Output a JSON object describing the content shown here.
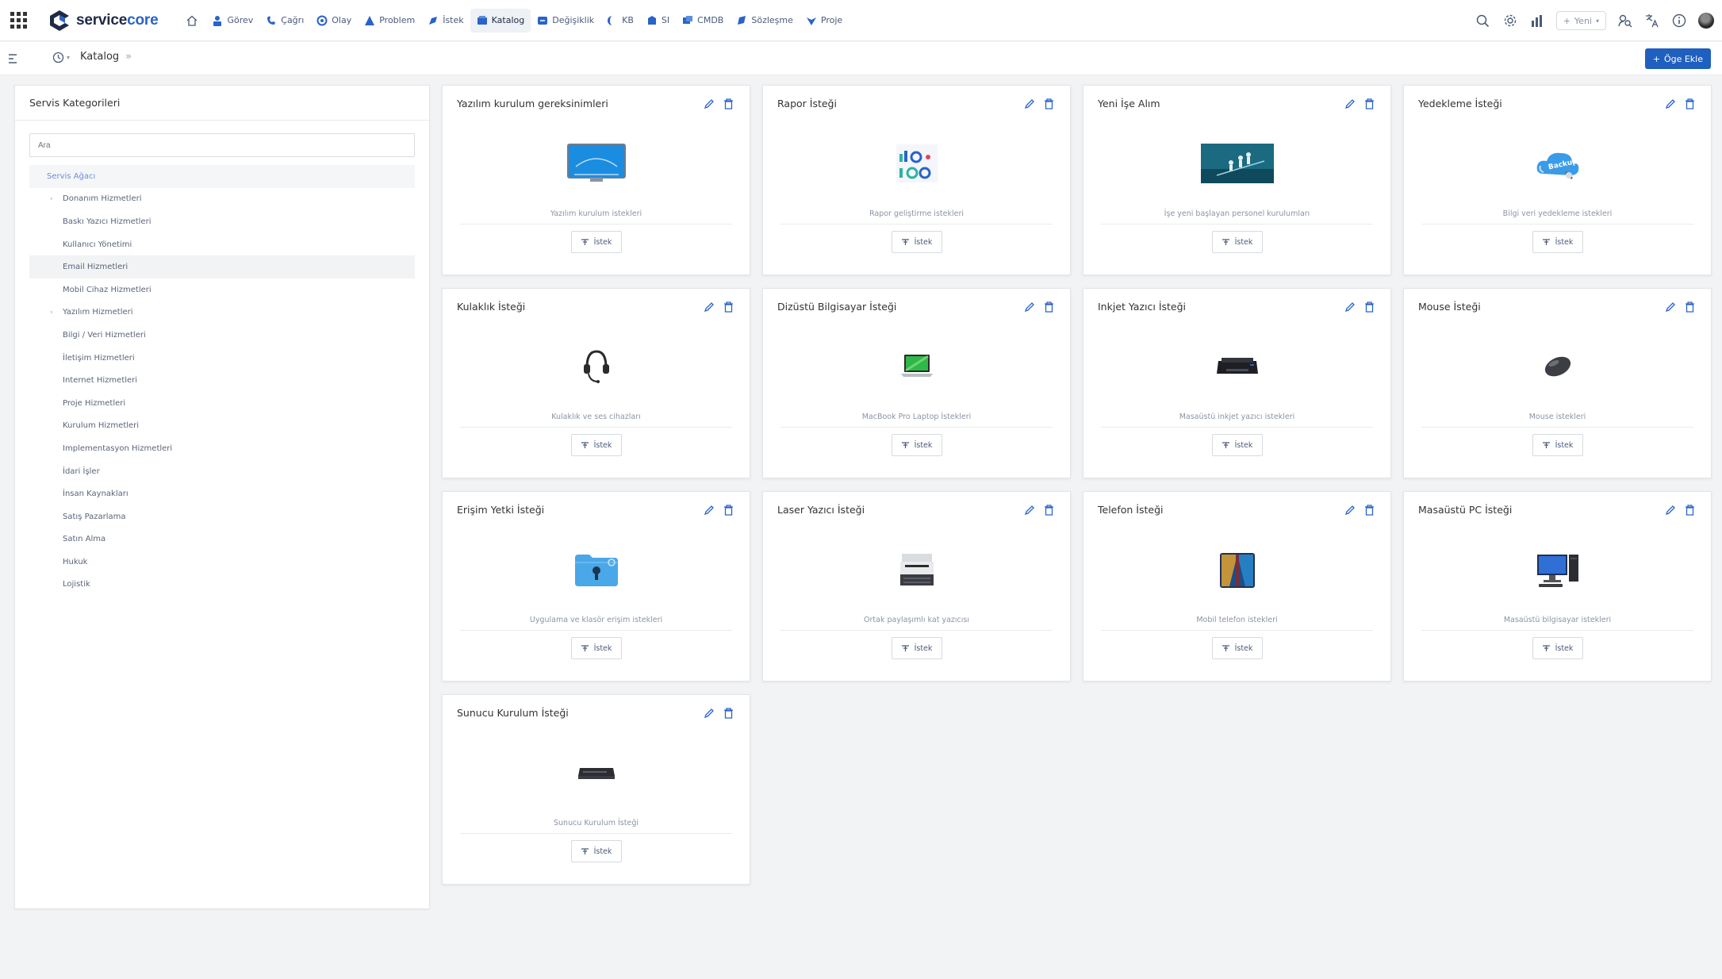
{
  "app": {
    "logo_prefix": "service",
    "logo_suffix": "core"
  },
  "nav": {
    "items": [
      {
        "label": "Görev",
        "icon": "task-icon",
        "color": "#2a63c9"
      },
      {
        "label": "Çağrı",
        "icon": "call-icon",
        "color": "#2a63c9"
      },
      {
        "label": "Olay",
        "icon": "incident-icon",
        "color": "#2a63c9"
      },
      {
        "label": "Problem",
        "icon": "problem-icon",
        "color": "#2a63c9"
      },
      {
        "label": "İstek",
        "icon": "request-icon",
        "color": "#2a63c9"
      },
      {
        "label": "Katalog",
        "icon": "catalog-icon",
        "color": "#2a63c9",
        "active": true
      },
      {
        "label": "Değişiklik",
        "icon": "change-icon",
        "color": "#2a63c9"
      },
      {
        "label": "KB",
        "icon": "kb-icon",
        "color": "#2a63c9"
      },
      {
        "label": "SI",
        "icon": "si-icon",
        "color": "#2a63c9"
      },
      {
        "label": "CMDB",
        "icon": "cmdb-icon",
        "color": "#2a63c9"
      },
      {
        "label": "Sözleşme",
        "icon": "contract-icon",
        "color": "#2a63c9"
      },
      {
        "label": "Proje",
        "icon": "project-icon",
        "color": "#2a63c9"
      }
    ],
    "new_label": "Yeni"
  },
  "subbar": {
    "breadcrumb": "Katalog",
    "add_button": "Öge Ekle"
  },
  "left_panel": {
    "title": "Servis Kategorileri",
    "search_placeholder": "Ara",
    "root": "Servis Ağacı",
    "items": [
      {
        "label": "Donanım Hizmetleri",
        "expandable": true
      },
      {
        "label": "Baskı Yazıcı Hizmetleri"
      },
      {
        "label": "Kullanıcı Yönetimi"
      },
      {
        "label": "Email Hizmetleri",
        "selected": true
      },
      {
        "label": "Mobil Cihaz Hizmetleri"
      },
      {
        "label": "Yazılım Hizmetleri",
        "expandable": true
      },
      {
        "label": "Bilgi / Veri Hizmetleri"
      },
      {
        "label": "İletişim Hizmetleri"
      },
      {
        "label": "Internet Hizmetleri"
      },
      {
        "label": "Proje Hizmetleri"
      },
      {
        "label": "Kurulum Hizmetleri"
      },
      {
        "label": "Implementasyon Hizmetleri"
      },
      {
        "label": "İdari İşler"
      },
      {
        "label": "İnsan Kaynakları"
      },
      {
        "label": "Satış Pazarlama"
      },
      {
        "label": "Satın Alma"
      },
      {
        "label": "Hukuk"
      },
      {
        "label": "Lojistik"
      }
    ]
  },
  "cards": [
    {
      "title": "Yazılım kurulum gereksinimleri",
      "desc": "Yazılım kurulum istekleri",
      "button": "İstek",
      "image": "monitor-image"
    },
    {
      "title": "Rapor İsteği",
      "desc": "Rapor geliştirme istekleri",
      "button": "İstek",
      "image": "report-image"
    },
    {
      "title": "Yeni İşe Alım",
      "desc": "İşe yeni başlayan personel kurulumları",
      "button": "İstek",
      "image": "onboarding-image"
    },
    {
      "title": "Yedekleme İsteği",
      "desc": "Bilgi veri yedekleme istekleri",
      "button": "İstek",
      "image": "backup-cloud-image",
      "image_text": "Backup"
    },
    {
      "title": "Kulaklık İsteği",
      "desc": "Kulaklık ve ses cihazları",
      "button": "İstek",
      "image": "headset-image"
    },
    {
      "title": "Dizüstü Bilgisayar İsteği",
      "desc": "MacBook Pro Laptop İstekleri",
      "button": "İstek",
      "image": "laptop-image"
    },
    {
      "title": "Inkjet Yazıcı İsteği",
      "desc": "Masaüstü inkjet yazıcı istekleri",
      "button": "İstek",
      "image": "inkjet-printer-image"
    },
    {
      "title": "Mouse İsteği",
      "desc": "Mouse istekleri",
      "button": "İstek",
      "image": "mouse-image"
    },
    {
      "title": "Erişim Yetki İsteği",
      "desc": "Uygulama ve klasör erişim istekleri",
      "button": "İstek",
      "image": "secure-folder-image"
    },
    {
      "title": "Laser Yazıcı İsteği",
      "desc": "Ortak paylaşımlı kat yazıcısı",
      "button": "İstek",
      "image": "laser-printer-image"
    },
    {
      "title": "Telefon İsteği",
      "desc": "Mobil telefon istekleri",
      "button": "İstek",
      "image": "tablet-image"
    },
    {
      "title": "Masaüstü PC İsteği",
      "desc": "Masaüstü bilgisayar istekleri",
      "button": "İstek",
      "image": "desktop-pc-image"
    },
    {
      "title": "Sunucu Kurulum İsteği",
      "desc": "Sunucu Kurulum İsteği",
      "button": "İstek",
      "image": "server-image"
    }
  ],
  "colors": {
    "primary": "#1f5fbf",
    "accent": "#2a63c9",
    "background": "#f2f3f5"
  }
}
